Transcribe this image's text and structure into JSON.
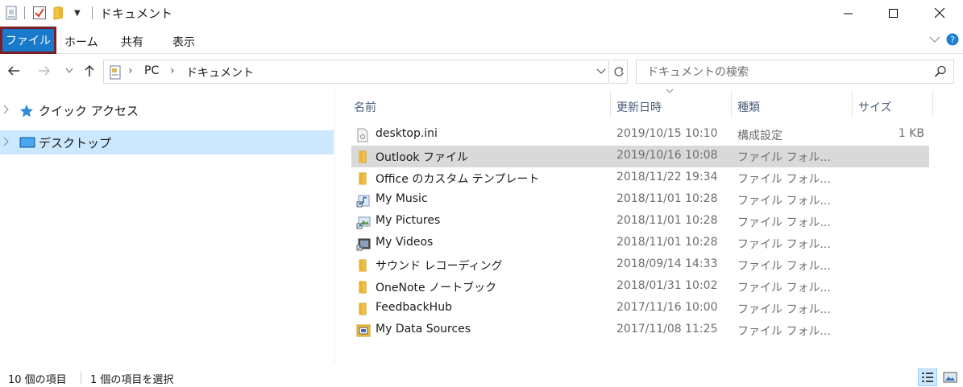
{
  "window": {
    "title": "ドキュメント"
  },
  "ribbon": {
    "file_tab": "ファイル",
    "tabs": [
      "ホーム",
      "共有",
      "表示"
    ]
  },
  "address": {
    "crumbs": [
      "PC",
      "ドキュメント"
    ]
  },
  "search": {
    "placeholder": "ドキュメントの検索"
  },
  "nav": {
    "items": [
      {
        "label": "クイック アクセス",
        "icon": "star-icon"
      },
      {
        "label": "デスクトップ",
        "icon": "desktop-icon"
      }
    ]
  },
  "columns": {
    "name": "名前",
    "date": "更新日時",
    "type": "種類",
    "size": "サイズ"
  },
  "files": [
    {
      "name": "desktop.ini",
      "date": "2019/10/15 10:10",
      "type": "構成設定",
      "size": "1 KB",
      "icon": "settings-file-icon"
    },
    {
      "name": "Outlook ファイル",
      "date": "2019/10/16 10:08",
      "type": "ファイル フォル...",
      "size": "",
      "icon": "folder-icon"
    },
    {
      "name": "Office のカスタム テンプレート",
      "date": "2018/11/22 19:34",
      "type": "ファイル フォル...",
      "size": "",
      "icon": "folder-icon"
    },
    {
      "name": "My Music",
      "date": "2018/11/01 10:28",
      "type": "ファイル フォル...",
      "size": "",
      "icon": "music-shortcut-icon"
    },
    {
      "name": "My Pictures",
      "date": "2018/11/01 10:28",
      "type": "ファイル フォル...",
      "size": "",
      "icon": "pictures-shortcut-icon"
    },
    {
      "name": "My Videos",
      "date": "2018/11/01 10:28",
      "type": "ファイル フォル...",
      "size": "",
      "icon": "videos-shortcut-icon"
    },
    {
      "name": "サウンド レコーディング",
      "date": "2018/09/14 14:33",
      "type": "ファイル フォル...",
      "size": "",
      "icon": "folder-icon"
    },
    {
      "name": "OneNote ノートブック",
      "date": "2018/01/31 10:02",
      "type": "ファイル フォル...",
      "size": "",
      "icon": "folder-icon"
    },
    {
      "name": "FeedbackHub",
      "date": "2017/11/16 10:00",
      "type": "ファイル フォル...",
      "size": "",
      "icon": "folder-icon"
    },
    {
      "name": "My Data Sources",
      "date": "2017/11/08 11:25",
      "type": "ファイル フォル...",
      "size": "",
      "icon": "data-sources-icon"
    }
  ],
  "status": {
    "count": "10 個の項目",
    "selected": "1 個の項目を選択"
  },
  "colors": {
    "accent": "#1979ca",
    "selection": "#cce8ff",
    "row_selected": "#d9d9d9",
    "file_tab_outline": "#7a1f2a",
    "folder": "#f5c342"
  }
}
